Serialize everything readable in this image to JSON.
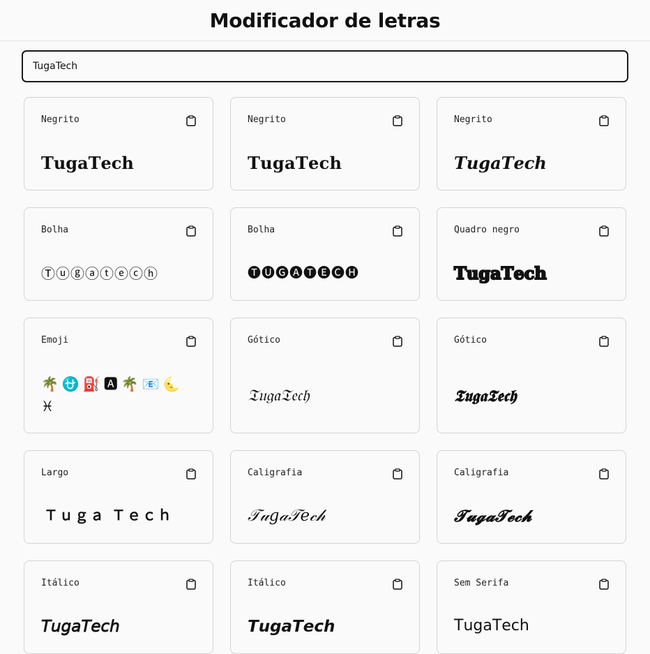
{
  "header": {
    "title": "Modificador de letras"
  },
  "search": {
    "value": "TugaTech"
  },
  "cards": [
    {
      "label": "Negrito",
      "text": "𝐓𝐮𝐠𝐚𝐓𝐞𝐜𝐡"
    },
    {
      "label": "Negrito",
      "text": "𝐓𝐮𝐠𝐚𝐓𝐞𝐜𝐡"
    },
    {
      "label": "Negrito",
      "text": "𝑻𝒖𝒈𝒂𝑻𝒆𝒄𝒉"
    },
    {
      "label": "Bolha",
      "text": "Ⓣⓤⓖⓐⓣⓔⓒⓗ"
    },
    {
      "label": "Bolha",
      "text": "🅣🅤🅖🅐🅣🅔🅒🅗"
    },
    {
      "label": "Quadro negro",
      "text": "𝕋𝕦𝕘𝕒𝕋𝕖𝕔𝕙"
    },
    {
      "label": "Emoji",
      "text": "🌴⛎⛽🅰🌴📧🌜♓"
    },
    {
      "label": "Gótico",
      "text": "𝔗𝔲𝔤𝔞𝔗𝔢𝔠𝔥"
    },
    {
      "label": "Gótico",
      "text": "𝕿𝖚𝖌𝖆𝕿𝖊𝖈𝖍"
    },
    {
      "label": "Largo",
      "text": "Ｔｕｇａ Ｔｅｃｈ"
    },
    {
      "label": "Caligrafia",
      "text": "𝒯𝓊𝑔𝒶𝒯𝑒𝒸𝒽"
    },
    {
      "label": "Caligrafia",
      "text": "𝓣𝓾𝓰𝓪𝓣𝓮𝓬𝓱"
    },
    {
      "label": "Itálico",
      "text": "𝘛𝘶𝘨𝘢𝘛𝘦𝘤𝘩"
    },
    {
      "label": "Itálico",
      "text": "𝙏𝙪𝙜𝙖𝙏𝙚𝙘𝙝"
    },
    {
      "label": "Sem Serifa",
      "text": "𝖳𝗎𝗀𝖺𝖳𝖾𝖼𝗁"
    }
  ]
}
